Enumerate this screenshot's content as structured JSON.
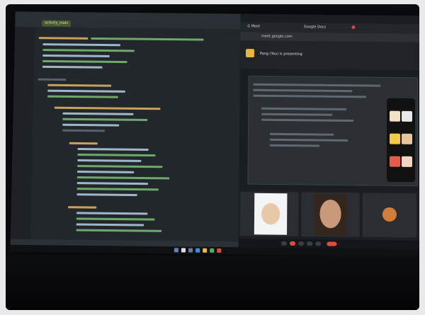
{
  "ide": {
    "active_tab": "activity_main"
  },
  "browser": {
    "tabs": [
      "G Meet",
      "Google Docs"
    ],
    "address": "meet.google.com"
  },
  "meet": {
    "share_text": "Pang (You) is presenting"
  }
}
